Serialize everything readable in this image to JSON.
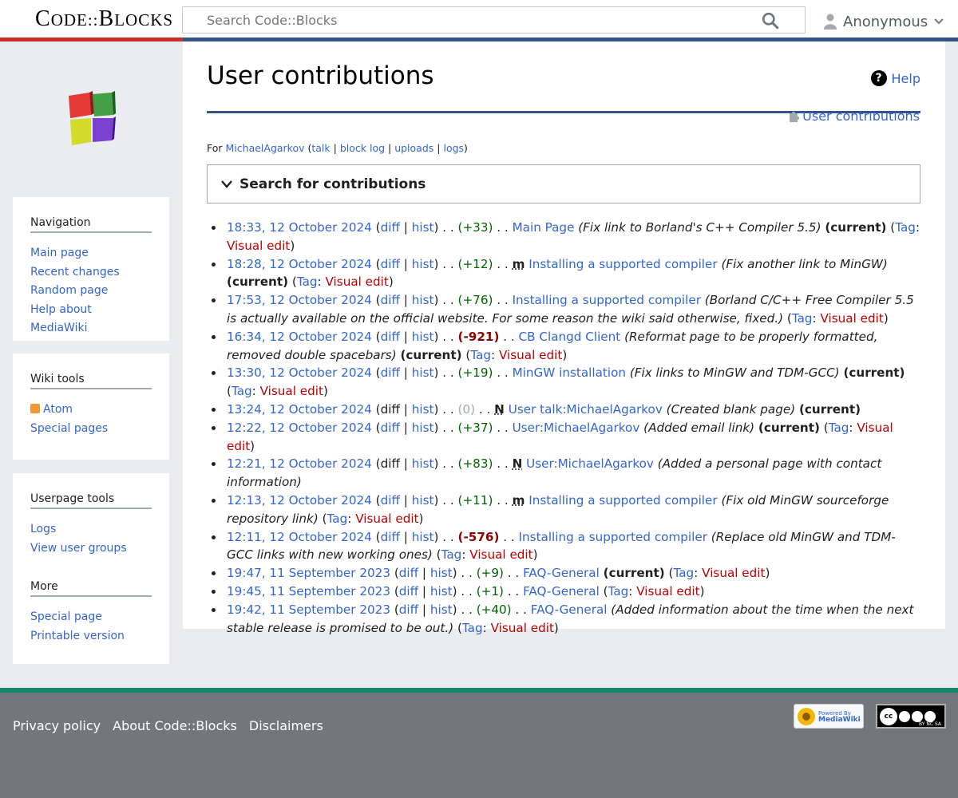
{
  "header": {
    "site_title_first": "C",
    "site_title_rest": "ODE::",
    "site_title_b": "B",
    "site_title_end": "LOCKS",
    "search_placeholder": "Search Code::Blocks",
    "user_label": "Anonymous"
  },
  "sidebar": {
    "navigation": {
      "heading": "Navigation",
      "items": [
        "Main page",
        "Recent changes",
        "Random page",
        "Help about MediaWiki"
      ]
    },
    "wiki_tools": {
      "heading": "Wiki tools",
      "items": [
        "Atom",
        "Special pages"
      ]
    },
    "userpage_tools": {
      "heading": "Userpage tools",
      "items": [
        "Logs",
        "View user groups"
      ]
    },
    "more": {
      "heading": "More",
      "items": [
        "Special page",
        "Printable version"
      ]
    }
  },
  "content": {
    "title": "User contributions",
    "help_label": "Help",
    "tool_link": "User contributions",
    "for_prefix": "For",
    "user_name": "MichaelAgarkov",
    "user_links": [
      "talk",
      "block log",
      "uploads",
      "logs"
    ],
    "search_toggle": "Search for contributions"
  },
  "contributions": [
    {
      "date": "18:33, 12 October 2024",
      "diff": "diff",
      "diff_link": true,
      "hist": "hist",
      "size": "(+33)",
      "size_class": "pos",
      "minor": "",
      "page": "Main Page",
      "page_red": false,
      "comment": "(Fix link to Borland's C++ Compiler 5.5)",
      "current": "(current)",
      "tag_label": "Tag",
      "tag": "Visual edit"
    },
    {
      "date": "18:28, 12 October 2024",
      "diff": "diff",
      "diff_link": true,
      "hist": "hist",
      "size": "(+12)",
      "size_class": "pos",
      "minor": "m",
      "page": "Installing a supported compiler",
      "page_red": false,
      "comment": "(Fix another link to MinGW)",
      "current": "(current)",
      "tag_label": "Tag",
      "tag": "Visual edit"
    },
    {
      "date": "17:53, 12 October 2024",
      "diff": "diff",
      "diff_link": true,
      "hist": "hist",
      "size": "(+76)",
      "size_class": "pos",
      "minor": "",
      "page": "Installing a supported compiler",
      "page_red": false,
      "comment": "(Borland C/C++ Free Compiler 5.5 is actually available on the official website. For some reason the wiki said otherwise, fixed.)",
      "current": "",
      "tag_label": "Tag",
      "tag": "Visual edit"
    },
    {
      "date": "16:34, 12 October 2024",
      "diff": "diff",
      "diff_link": true,
      "hist": "hist",
      "size": "(-921)",
      "size_class": "neg",
      "minor": "",
      "page": "CB Clangd Client",
      "page_red": false,
      "comment": "(Reformat page to be properly formatted, removed double spacebars)",
      "current": "(current)",
      "tag_label": "Tag",
      "tag": "Visual edit"
    },
    {
      "date": "13:30, 12 October 2024",
      "diff": "diff",
      "diff_link": true,
      "hist": "hist",
      "size": "(+19)",
      "size_class": "pos",
      "minor": "",
      "page": "MinGW installation",
      "page_red": false,
      "comment": "(Fix links to MinGW and TDM-GCC)",
      "current": "(current)",
      "tag_label": "Tag",
      "tag": "Visual edit"
    },
    {
      "date": "13:24, 12 October 2024",
      "diff": "diff",
      "diff_link": false,
      "hist": "hist",
      "size": "(0)",
      "size_class": "zero",
      "minor": "N",
      "page": "User talk:MichaelAgarkov",
      "page_red": false,
      "comment": "(Created blank page)",
      "current": "(current)",
      "tag_label": "",
      "tag": ""
    },
    {
      "date": "12:22, 12 October 2024",
      "diff": "diff",
      "diff_link": true,
      "hist": "hist",
      "size": "(+37)",
      "size_class": "pos",
      "minor": "",
      "page": "User:MichaelAgarkov",
      "page_red": false,
      "comment": "(Added email link)",
      "current": "(current)",
      "tag_label": "Tag",
      "tag": "Visual edit"
    },
    {
      "date": "12:21, 12 October 2024",
      "diff": "diff",
      "diff_link": false,
      "hist": "hist",
      "size": "(+83)",
      "size_class": "pos",
      "minor": "N",
      "page": "User:MichaelAgarkov",
      "page_red": false,
      "comment": "(Added a personal page with contact information)",
      "current": "",
      "tag_label": "",
      "tag": ""
    },
    {
      "date": "12:13, 12 October 2024",
      "diff": "diff",
      "diff_link": true,
      "hist": "hist",
      "size": "(+11)",
      "size_class": "pos",
      "minor": "m",
      "page": "Installing a supported compiler",
      "page_red": false,
      "comment": "(Fix old MinGW sourceforge repository link)",
      "current": "",
      "tag_label": "Tag",
      "tag": "Visual edit"
    },
    {
      "date": "12:11, 12 October 2024",
      "diff": "diff",
      "diff_link": true,
      "hist": "hist",
      "size": "(-576)",
      "size_class": "neg",
      "minor": "",
      "page": "Installing a supported compiler",
      "page_red": false,
      "comment": "(Replace old MinGW and TDM-GCC links with new working ones)",
      "current": "",
      "tag_label": "Tag",
      "tag": "Visual edit"
    },
    {
      "date": "19:47, 11 September 2023",
      "diff": "diff",
      "diff_link": true,
      "hist": "hist",
      "size": "(+9)",
      "size_class": "pos",
      "minor": "",
      "page": "FAQ-General",
      "page_red": false,
      "comment": "",
      "current": "(current)",
      "tag_label": "Tag",
      "tag": "Visual edit"
    },
    {
      "date": "19:45, 11 September 2023",
      "diff": "diff",
      "diff_link": true,
      "hist": "hist",
      "size": "(+1)",
      "size_class": "pos",
      "minor": "",
      "page": "FAQ-General",
      "page_red": false,
      "comment": "",
      "current": "",
      "tag_label": "Tag",
      "tag": "Visual edit"
    },
    {
      "date": "19:42, 11 September 2023",
      "diff": "diff",
      "diff_link": true,
      "hist": "hist",
      "size": "(+40)",
      "size_class": "pos",
      "minor": "",
      "page": "FAQ-General",
      "page_red": false,
      "comment": "(Added information about the time when the next stable release is promised to be out.)",
      "current": "",
      "tag_label": "Tag",
      "tag": "Visual edit"
    }
  ],
  "footer": {
    "links": [
      "Privacy policy",
      "About Code::Blocks",
      "Disclaimers"
    ],
    "mw_badge_small": "Powered By",
    "mw_badge_big": "MediaWiki",
    "cc_badge_text": "cc",
    "cc_badge_sub": "BY NC SA"
  },
  "colors": {
    "accent_red": "#c9302c",
    "accent_blue": "#36528c",
    "link": "#3366cc",
    "redlink": "#ba0000",
    "footer_bg": "#72777d",
    "footer_top": "#14866d"
  },
  "icons": [
    "search-icon",
    "user-icon",
    "chevron-down-icon",
    "help-icon",
    "puzzle-icon",
    "rss-icon",
    "chevron-toggle-icon"
  ]
}
